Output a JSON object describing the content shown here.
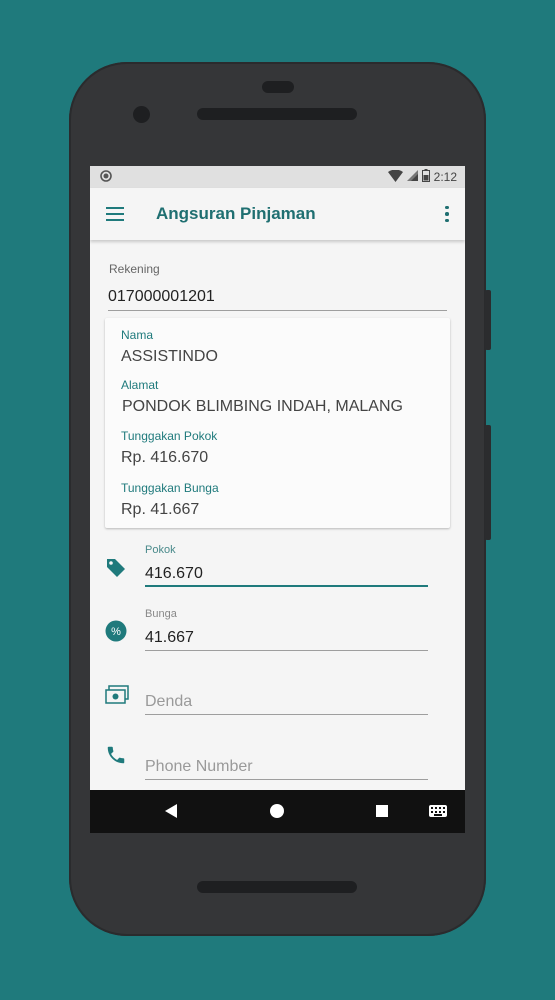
{
  "status": {
    "time": "2:12"
  },
  "appbar": {
    "title": "Angsuran Pinjaman"
  },
  "rekening": {
    "label": "Rekening",
    "value": "017000001201"
  },
  "info_card": {
    "nama_label": "Nama",
    "nama_value": "ASSISTINDO",
    "alamat_label": "Alamat",
    "alamat_value": "PONDOK BLIMBING INDAH, MALANG",
    "tunggakan_pokok_label": "Tunggakan Pokok",
    "tunggakan_pokok_value": "Rp. 416.670",
    "tunggakan_bunga_label": "Tunggakan Bunga",
    "tunggakan_bunga_value": "Rp. 41.667"
  },
  "fields": {
    "pokok": {
      "label": "Pokok",
      "value": "416.670",
      "icon": "tag-icon"
    },
    "bunga": {
      "label": "Bunga",
      "value": "41.667",
      "icon": "percent-badge-icon"
    },
    "denda": {
      "placeholder": "Denda",
      "icon": "money-icon"
    },
    "phone": {
      "placeholder": "Phone Number",
      "icon": "phone-icon"
    }
  },
  "colors": {
    "accent": "#1f7a7c",
    "background": "#1f7a7c"
  }
}
